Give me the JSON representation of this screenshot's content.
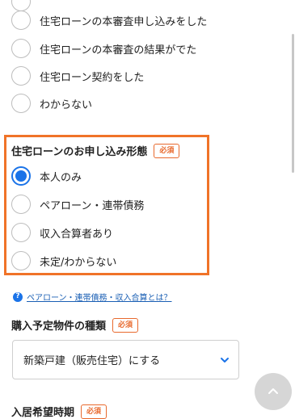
{
  "status_options": [
    "住宅ローンの本審査申し込みをした",
    "住宅ローンの本審査の結果がでた",
    "住宅ローン契約をした",
    "わからない"
  ],
  "application_type": {
    "title": "住宅ローンのお申し込み形態",
    "required_badge": "必須",
    "options": [
      "本人のみ",
      "ペアローン・連帯債務",
      "収入合算者あり",
      "未定/わからない"
    ],
    "selected_index": 0
  },
  "help_link": {
    "icon": "question-circle-icon",
    "text": "ペアローン・連帯債務・収入合算とは？"
  },
  "property_type": {
    "title": "購入予定物件の種類",
    "required_badge": "必須",
    "selected_value": "新築戸建（販売住宅）にする"
  },
  "move_in": {
    "title": "入居希望時期",
    "required_badge": "必須"
  },
  "colors": {
    "accent_blue": "#1a73e8",
    "highlight_orange": "#f07328",
    "badge_orange": "#e8692d"
  },
  "icons": {
    "select_arrow": "chevron-down-icon",
    "scroll_top": "chevron-up-icon"
  }
}
